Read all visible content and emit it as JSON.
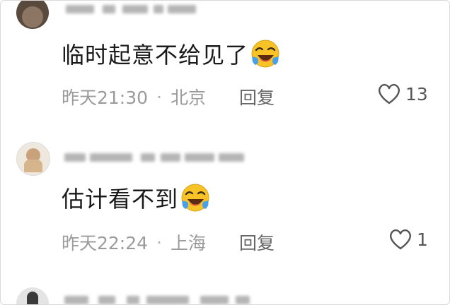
{
  "comments": [
    {
      "text": "临时起意不给见了",
      "time": "昨天21:30",
      "location": "北京",
      "reply_label": "回复",
      "likes": "13",
      "emoji": "grinning-tears-emoji"
    },
    {
      "text": "估计看不到",
      "time": "昨天22:24",
      "location": "上海",
      "reply_label": "回复",
      "likes": "1",
      "emoji": "grinning-tears-emoji"
    }
  ],
  "separator": "·",
  "colors": {
    "text": "#1a1a1a",
    "meta": "#9b9b9b",
    "emoji_face": "#f7c326",
    "emoji_tear": "#4aa0e8"
  }
}
